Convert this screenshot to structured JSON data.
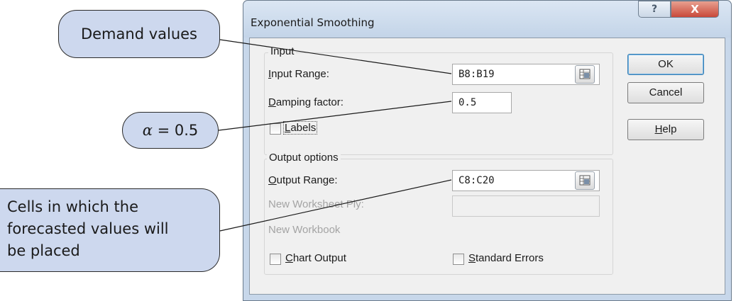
{
  "callouts": {
    "demand": "Demand values",
    "alpha_symbol": "α",
    "alpha_value": " = 0.5",
    "cells_line1": "Cells in which the",
    "cells_line2": "forecasted values will",
    "cells_line3": "be placed"
  },
  "dialog": {
    "title": "Exponential Smoothing",
    "help_glyph": "?",
    "close_glyph": "X",
    "input_group": "Input",
    "input_range_label_u": "I",
    "input_range_label_rest": "nput Range:",
    "input_range_value": "B8:B19",
    "damping_label_u": "D",
    "damping_label_rest": "amping factor:",
    "damping_value": "0.5",
    "labels_u": "L",
    "labels_rest": "abels",
    "output_group": "Output options",
    "output_range_label_u": "O",
    "output_range_label_rest": "utput Range:",
    "output_range_value": "C8:C20",
    "new_ply_label": "New Worksheet Ply:",
    "new_ply_value": "",
    "new_workbook_label": "New Workbook",
    "chart_output_u": "C",
    "chart_output_rest": "hart Output",
    "std_errors_u": "S",
    "std_errors_rest": "tandard Errors",
    "ok_label": "OK",
    "cancel_label": "Cancel",
    "help_u": "H",
    "help_rest": "elp"
  },
  "colors": {
    "callout_fill": "#cdd8ee",
    "window_frame": "#c7d7ea",
    "client_bg": "#f0f0f0",
    "close_button": "#c9493a"
  }
}
